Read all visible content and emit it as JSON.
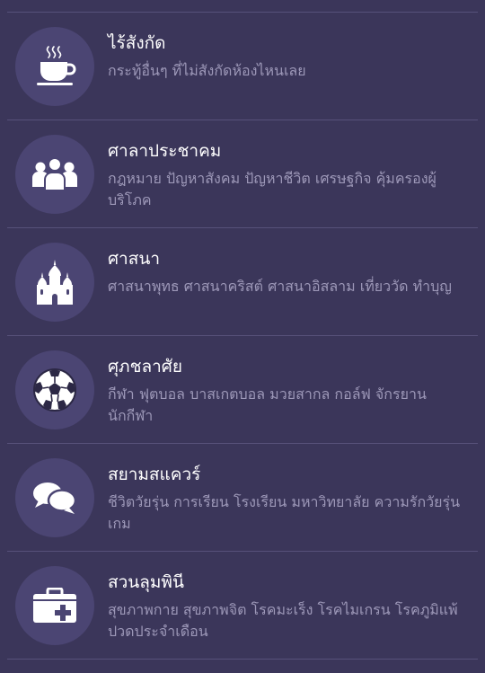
{
  "forums": [
    {
      "title": "ไร้สังกัด",
      "description": "กระทู้อื่นๆ ที่ไม่สังกัดห้องไหนเลย",
      "icon": "coffee-cup-icon"
    },
    {
      "title": "ศาลาประชาคม",
      "description": "กฎหมาย ปัญหาสังคม ปัญหาชีวิต เศรษฐกิจ คุ้มครองผู้บริโภค",
      "icon": "people-group-icon"
    },
    {
      "title": "ศาสนา",
      "description": "ศาสนาพุทธ ศาสนาคริสต์ ศาสนาอิสลาม เที่ยววัด ทำบุญ",
      "icon": "temple-icon"
    },
    {
      "title": "ศุภชลาศัย",
      "description": "กีฬา ฟุตบอล บาสเกตบอล มวยสากล กอล์ฟ จักรยาน นักกีฬา",
      "icon": "soccer-ball-icon"
    },
    {
      "title": "สยามสแควร์",
      "description": "ชีวิตวัยรุ่น การเรียน โรงเรียน มหาวิทยาลัย ความรักวัยรุ่น เกม",
      "icon": "chat-bubbles-icon"
    },
    {
      "title": "สวนลุมพินี",
      "description": "สุขภาพกาย สุขภาพจิต โรคมะเร็ง โรคไมเกรน โรคภูมิแพ้ ปวดประจำเดือน",
      "icon": "first-aid-kit-icon"
    }
  ]
}
